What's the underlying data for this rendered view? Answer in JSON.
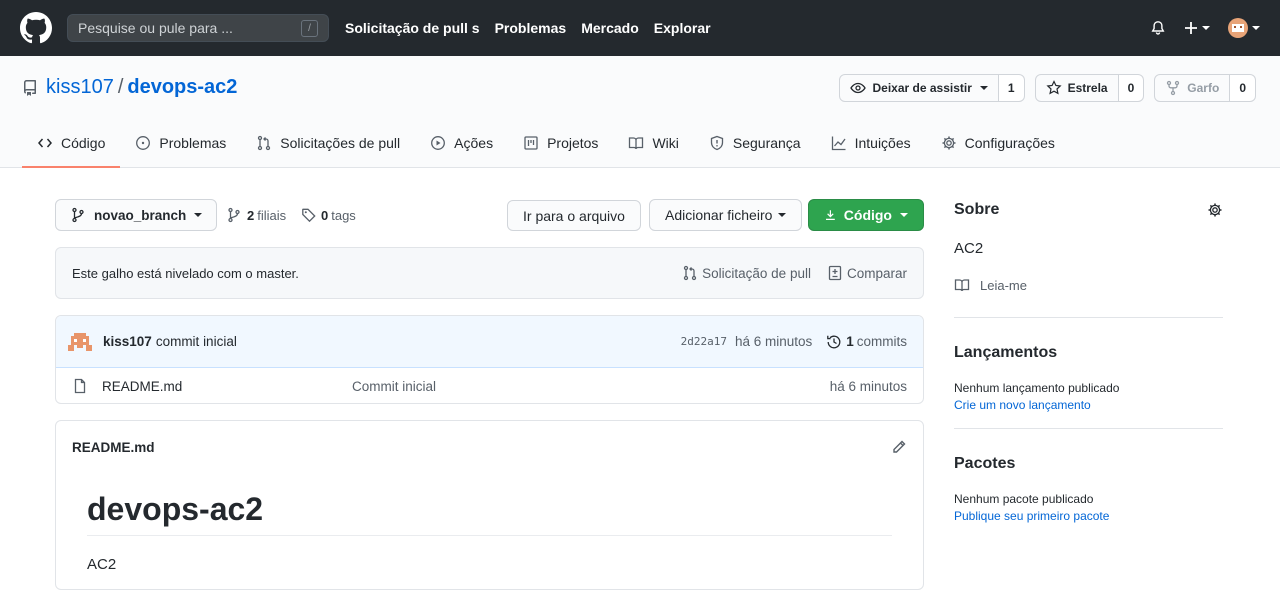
{
  "header": {
    "search_placeholder": "Pesquise ou pule para ...",
    "search_shortcut": "/",
    "nav": [
      "Solicitação de pull s",
      "Problemas",
      "Mercado",
      "Explorar"
    ]
  },
  "repo": {
    "owner": "kiss107",
    "separator": "/",
    "name": "devops-ac2",
    "watch": {
      "label": "Deixar de assistir",
      "count": "1"
    },
    "star": {
      "label": "Estrela",
      "count": "0"
    },
    "fork": {
      "label": "Garfo",
      "count": "0"
    }
  },
  "tabs": [
    {
      "label": "Código",
      "icon": "code-icon"
    },
    {
      "label": "Problemas",
      "icon": "issue-icon"
    },
    {
      "label": "Solicitações de pull",
      "icon": "pull-request-icon"
    },
    {
      "label": "Ações",
      "icon": "play-icon"
    },
    {
      "label": "Projetos",
      "icon": "project-icon"
    },
    {
      "label": "Wiki",
      "icon": "book-icon"
    },
    {
      "label": "Segurança",
      "icon": "shield-icon"
    },
    {
      "label": "Intuições",
      "icon": "graph-icon"
    },
    {
      "label": "Configurações",
      "icon": "gear-icon"
    }
  ],
  "filebar": {
    "branch": "novao_branch",
    "branches_count": "2",
    "branches_label": "filiais",
    "tags_count": "0",
    "tags_label": "tags",
    "goto_file": "Ir para o arquivo",
    "add_file": "Adicionar ficheiro",
    "code": "Código"
  },
  "flash": {
    "message": "Este galho está nivelado com o master.",
    "pull_request": "Solicitação de pull",
    "compare": "Comparar"
  },
  "commit": {
    "author": "kiss107",
    "message": "commit inicial",
    "sha": "2d22a17",
    "time": "há 6 minutos",
    "count": "1",
    "count_label": "commits"
  },
  "files": [
    {
      "name": "README.md",
      "message": "Commit inicial",
      "time": "há 6 minutos"
    }
  ],
  "readme": {
    "filename": "README.md",
    "title": "devops-ac2",
    "body": "AC2"
  },
  "sidebar": {
    "about_title": "Sobre",
    "description": "AC2",
    "readme_link": "Leia-me",
    "releases_title": "Lançamentos",
    "releases_text": "Nenhum lançamento publicado",
    "releases_link": "Crie um novo lançamento",
    "packages_title": "Pacotes",
    "packages_text": "Nenhum pacote publicado",
    "packages_link": "Publique seu primeiro pacote"
  }
}
